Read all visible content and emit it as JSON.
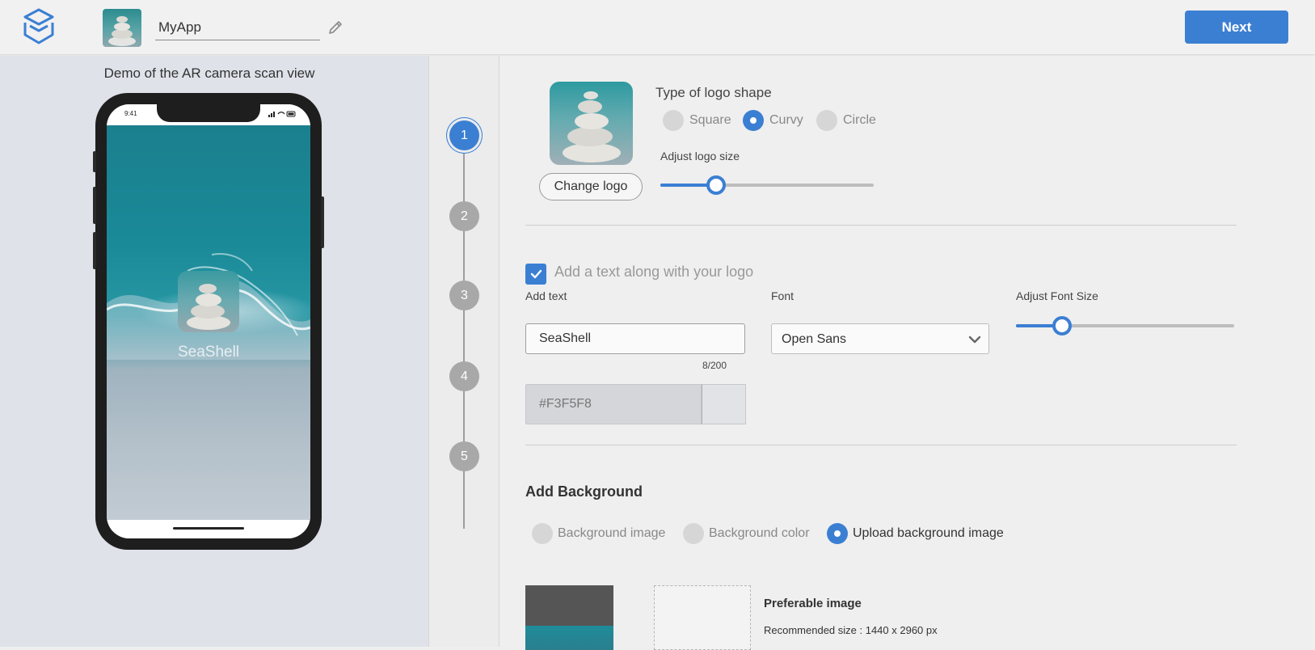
{
  "header": {
    "app_name": "MyApp",
    "next_label": "Next",
    "accent": "#3b7fd3"
  },
  "demo": {
    "title": "Demo of the AR camera scan view",
    "status_time": "9:41",
    "screen_text": "SeaShell"
  },
  "stepper": {
    "steps": [
      "1",
      "2",
      "3",
      "4",
      "5"
    ],
    "active_step": "1"
  },
  "logo_section": {
    "change_logo_label": "Change logo",
    "shape_title": "Type of logo shape",
    "shapes": [
      "Square",
      "Curvy",
      "Circle"
    ],
    "selected_shape": "Curvy",
    "size_label": "Adjust logo size",
    "logo_size_fraction": 0.26
  },
  "text_section": {
    "checkbox_label": "Add a text along with your logo",
    "checked": true,
    "add_text_label": "Add text",
    "text_value": "SeaShell",
    "counter": "8/200",
    "font_label": "Font",
    "font_value": "Open Sans",
    "font_size_label": "Adjust Font Size",
    "font_size_fraction": 0.21,
    "color_value": "#F3F5F8"
  },
  "background_section": {
    "title": "Add Background",
    "options": [
      "Background image",
      "Background color",
      "Upload background image"
    ],
    "selected_option": "Upload background image",
    "preferable_title": "Preferable image",
    "recommended_size": "Recommended size : 1440 x 2960 px"
  }
}
